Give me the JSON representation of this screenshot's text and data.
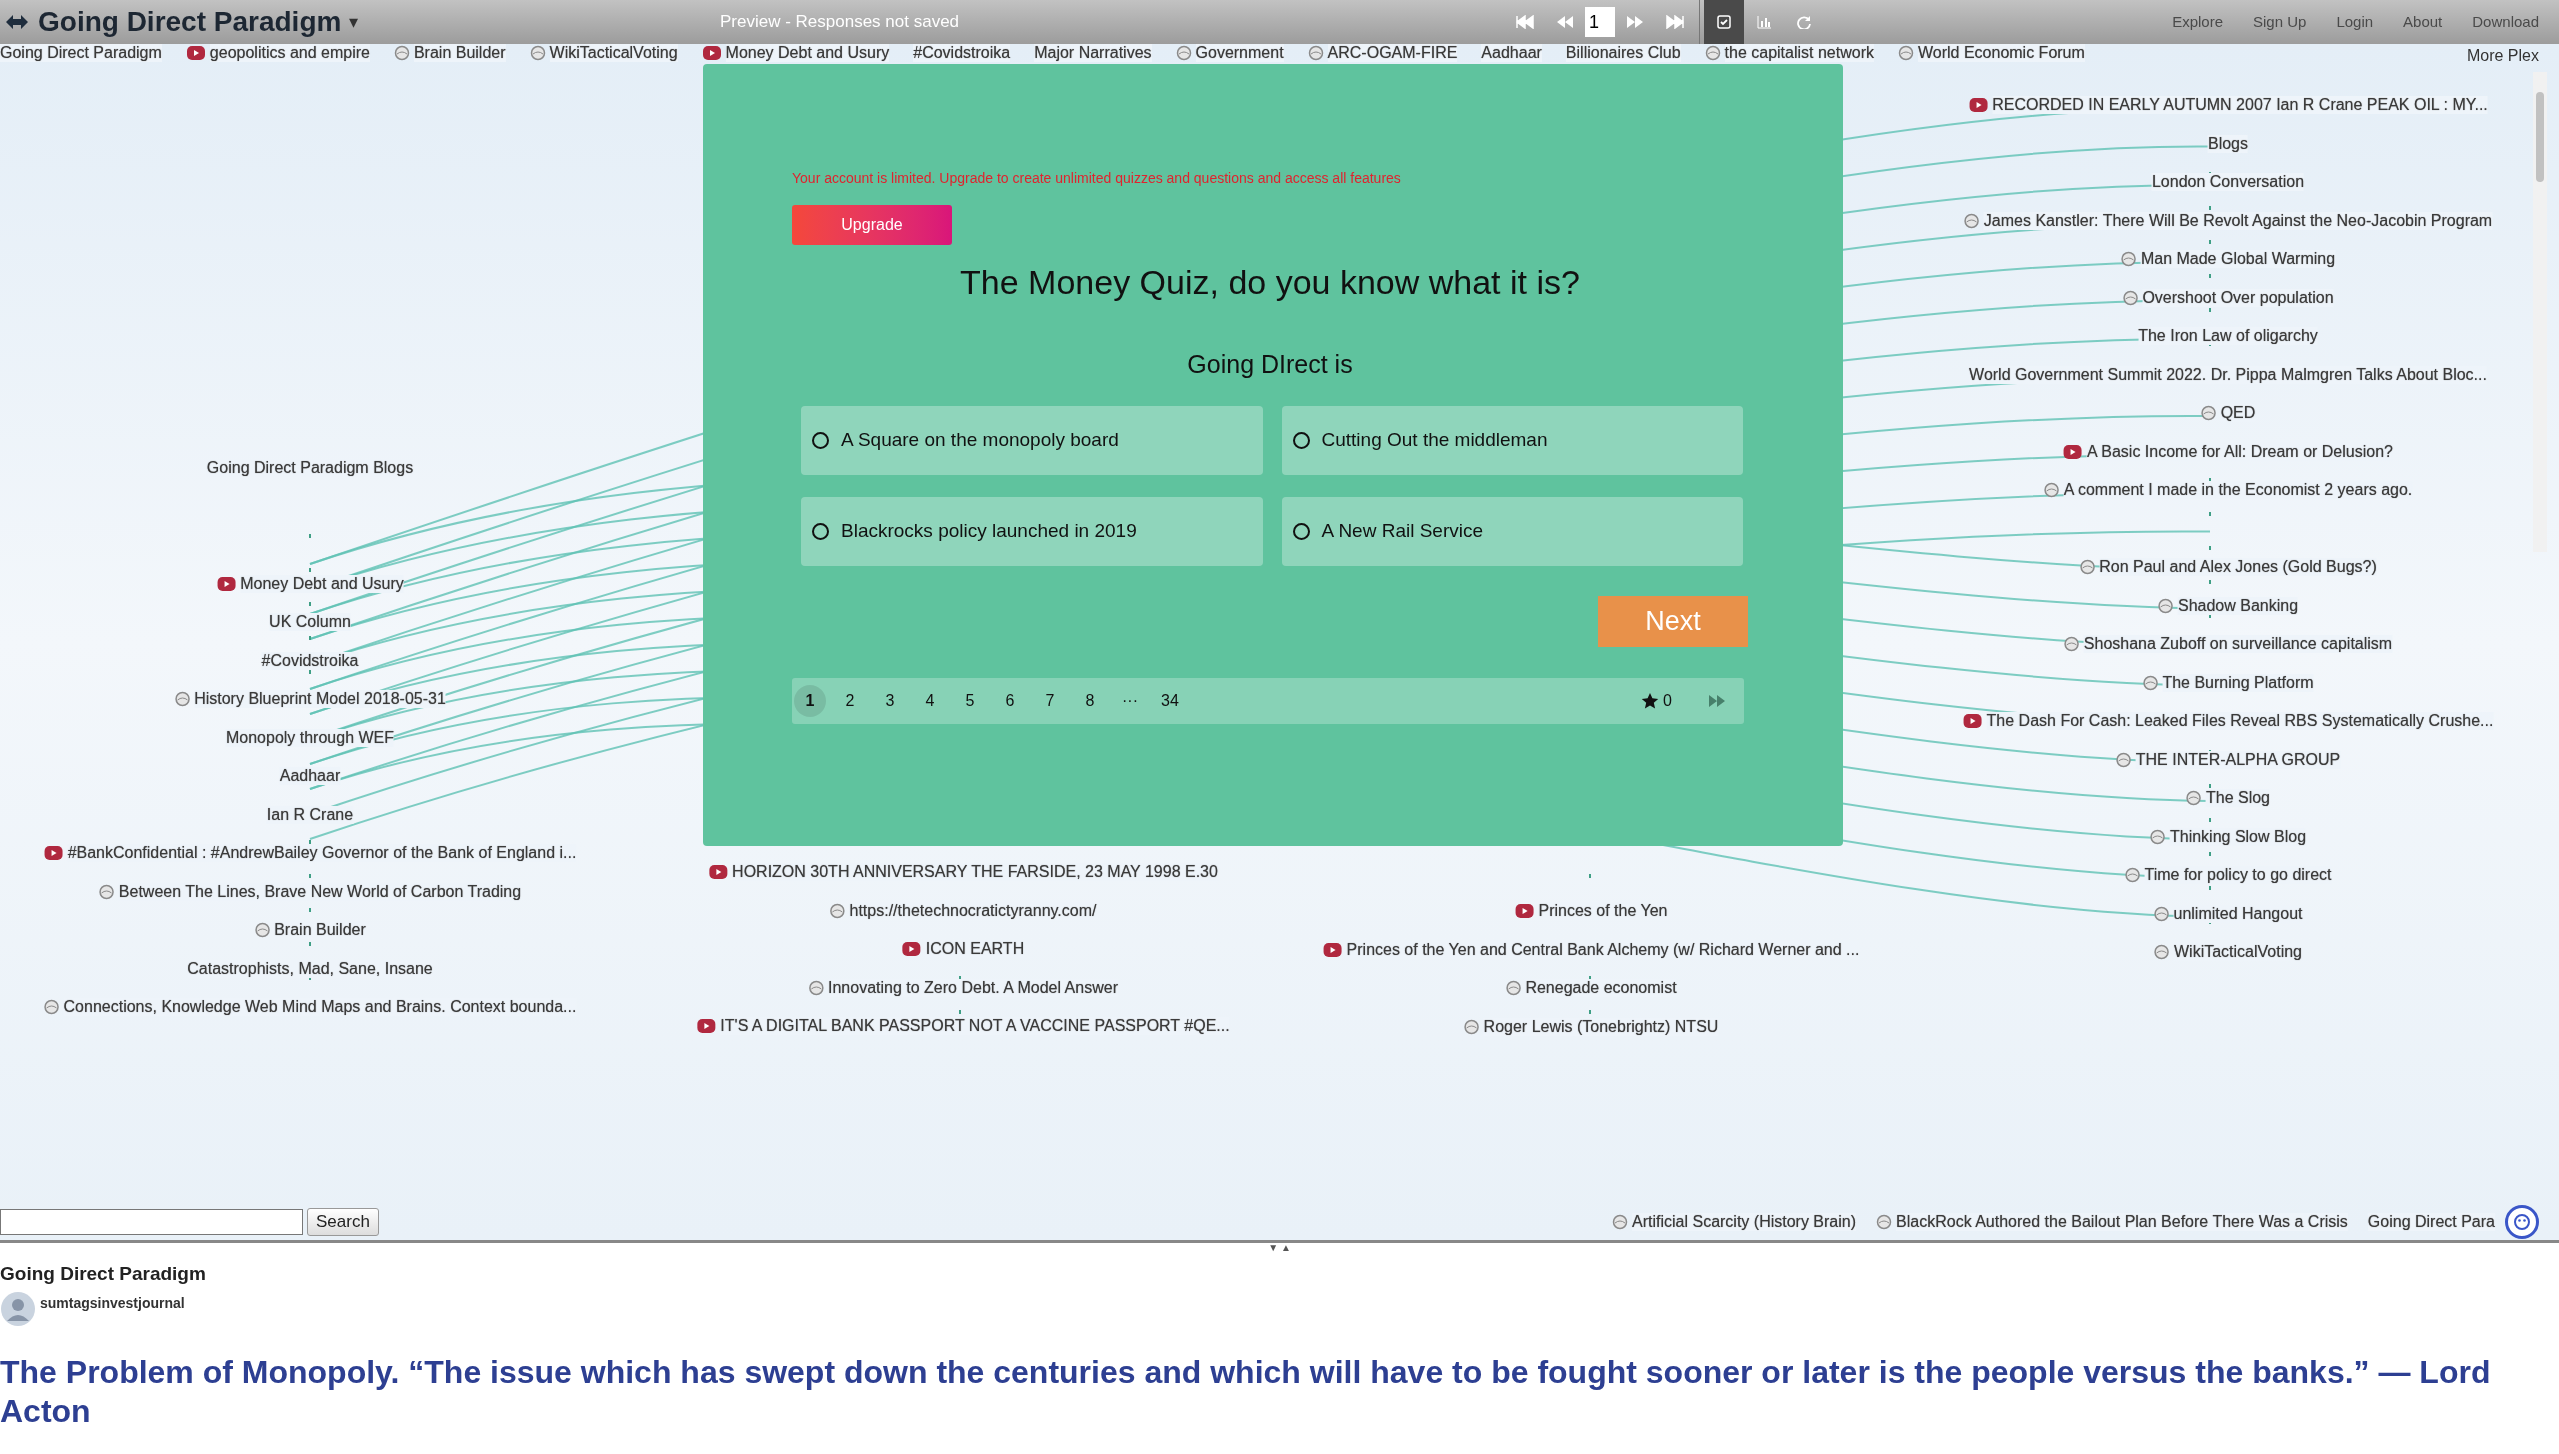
{
  "top_bar": {
    "title": "Going Direct Paradigm",
    "caret": "▾",
    "preview_note": "Preview - Responses not saved",
    "page_input": "1",
    "tools": [
      {
        "kind": "chart-check",
        "selected": true
      },
      {
        "kind": "chart-bars",
        "selected": false
      },
      {
        "kind": "refresh",
        "selected": false
      }
    ],
    "links": [
      "Explore",
      "Sign Up",
      "Login",
      "About",
      "Download"
    ]
  },
  "link_row": [
    {
      "label": "Going Direct Paradigm",
      "kind": "text"
    },
    {
      "label": "geopolitics and empire",
      "kind": "video"
    },
    {
      "label": "Brain Builder",
      "kind": "page"
    },
    {
      "label": "WikiTacticalVoting",
      "kind": "page"
    },
    {
      "label": "Money Debt and Usury",
      "kind": "video"
    },
    {
      "label": "#Covidstroika",
      "kind": "text"
    },
    {
      "label": "Major Narratives",
      "kind": "text"
    },
    {
      "label": "Government",
      "kind": "page"
    },
    {
      "label": "ARC-OGAM-FIRE",
      "kind": "page"
    },
    {
      "label": "Aadhaar",
      "kind": "text"
    },
    {
      "label": "Billionaires Club",
      "kind": "text"
    },
    {
      "label": "the capitalist network",
      "kind": "page"
    },
    {
      "label": "World Economic Forum",
      "kind": "page"
    }
  ],
  "more_label": "More Plex",
  "map_columns": [
    {
      "nodes": [
        {
          "label": "Going Direct Paradigm Blogs",
          "kind": "text"
        },
        {
          "kind": "gap"
        },
        {
          "kind": "gap"
        },
        {
          "label": "Money Debt and Usury",
          "kind": "video"
        },
        {
          "label": "UK Column",
          "kind": "text"
        },
        {
          "label": "#Covidstroika",
          "kind": "text"
        },
        {
          "label": "History Blueprint Model 2018-05-31",
          "kind": "page"
        },
        {
          "label": "Monopoly through WEF",
          "kind": "text"
        },
        {
          "label": "Aadhaar",
          "kind": "text"
        },
        {
          "label": "Ian R Crane",
          "kind": "text"
        },
        {
          "label": "#BankConfidential : #AndrewBailey Governor of the Bank of England i...",
          "kind": "video"
        },
        {
          "label": "Between The Lines, Brave New World of Carbon Trading",
          "kind": "page"
        },
        {
          "label": "Brain Builder",
          "kind": "page"
        },
        {
          "label": "Catastrophists, Mad, Sane, Insane",
          "kind": "text"
        },
        {
          "label": "Connections, Knowledge Web Mind Maps and Brains. Context bounda...",
          "kind": "page"
        }
      ]
    },
    {
      "nodes": [
        {
          "label": "HORIZON 30TH ANNIVERSARY THE FARSIDE, 23 MAY 1998 E.30",
          "kind": "video"
        },
        {
          "label": "https://thetechnocratictyranny.com/",
          "kind": "page"
        },
        {
          "label": "ICON EARTH",
          "kind": "video"
        },
        {
          "label": "Innovating to Zero Debt. A Model Answer",
          "kind": "page"
        },
        {
          "label": "IT'S A DIGITAL BANK PASSPORT NOT A VACCINE PASSPORT #QE...",
          "kind": "video"
        }
      ]
    },
    {
      "nodes": [
        {
          "label": "Princes of the Yen",
          "kind": "video"
        },
        {
          "label": "Princes of the Yen and Central Bank Alchemy (w/ Richard Werner and ...",
          "kind": "video"
        },
        {
          "label": "Renegade economist",
          "kind": "page"
        },
        {
          "label": "Roger Lewis (Tonebrightz) NTSU",
          "kind": "page"
        }
      ]
    },
    {
      "nodes": [
        {
          "label": "RECORDED IN EARLY AUTUMN 2007 Ian R Crane PEAK OIL : MY...",
          "kind": "video"
        },
        {
          "label": "Blogs",
          "kind": "text"
        },
        {
          "label": "London Conversation",
          "kind": "text"
        },
        {
          "label": "James Kanstler: There Will Be Revolt Against the Neo-Jacobin Program",
          "kind": "page"
        },
        {
          "label": "Man Made Global Warming",
          "kind": "page"
        },
        {
          "label": "Overshoot Over population",
          "kind": "page"
        },
        {
          "label": "The Iron Law of oligarchy",
          "kind": "text"
        },
        {
          "label": "World Government Summit 2022. Dr. Pippa Malmgren Talks About Bloc...",
          "kind": "text"
        },
        {
          "label": "QED",
          "kind": "page"
        },
        {
          "label": "A Basic Income for All: Dream or Delusion?",
          "kind": "video"
        },
        {
          "label": "A comment I made in the Economist 2 years ago.",
          "kind": "page"
        },
        {
          "kind": "gap"
        },
        {
          "label": "Ron Paul and Alex Jones (Gold Bugs?)",
          "kind": "page"
        },
        {
          "label": "Shadow Banking",
          "kind": "page"
        },
        {
          "label": "Shoshana Zuboff on surveillance capitalism",
          "kind": "page"
        },
        {
          "label": "The Burning Platform",
          "kind": "page"
        },
        {
          "label": "The Dash For Cash: Leaked Files Reveal RBS Systematically Crushe...",
          "kind": "video"
        },
        {
          "label": "THE INTER-ALPHA GROUP",
          "kind": "page"
        },
        {
          "label": "The Slog",
          "kind": "page"
        },
        {
          "label": "Thinking Slow Blog",
          "kind": "page"
        },
        {
          "label": "Time for policy to go direct",
          "kind": "page"
        },
        {
          "label": "unlimited Hangout",
          "kind": "page"
        },
        {
          "label": "WikiTacticalVoting",
          "kind": "page"
        }
      ]
    }
  ],
  "quiz": {
    "notice": "Your account is limited. Upgrade to create unlimited quizzes and questions and access all features",
    "upgrade_button": "Upgrade",
    "title": "The Money Quiz, do you know what it is?",
    "question": "Going DIrect is",
    "options": [
      {
        "label": "A Square on the monopoly board",
        "selected": false
      },
      {
        "label": "Cutting Out the middleman",
        "selected": false
      },
      {
        "label": "Blackrocks policy launched in 2019",
        "selected": false
      },
      {
        "label": "A New Rail Service",
        "selected": false
      }
    ],
    "next_button": "Next",
    "pages": [
      {
        "label": "1",
        "selected": true
      },
      {
        "label": "2",
        "selected": false
      },
      {
        "label": "3",
        "selected": false
      },
      {
        "label": "4",
        "selected": false
      },
      {
        "label": "5",
        "selected": false
      },
      {
        "label": "6",
        "selected": false
      },
      {
        "label": "7",
        "selected": false
      },
      {
        "label": "8",
        "selected": false
      },
      {
        "label": "···",
        "selected": false
      },
      {
        "label": "34",
        "selected": false
      }
    ],
    "score": "0"
  },
  "bottom_bar": {
    "search_button": "Search",
    "links": [
      {
        "label": "Artificial Scarcity (History Brain)",
        "kind": "page"
      },
      {
        "label": "BlackRock Authored the Bailout Plan Before There Was a Crisis",
        "kind": "page"
      },
      {
        "label": "Going Direct Para",
        "kind": "text"
      }
    ]
  },
  "splitter": "▼ ▲",
  "details": {
    "title": "Going Direct Paradigm",
    "author": "sumtagsinvestjournal",
    "heading": "The Problem of Monopoly. “The issue which has swept down the centuries and which will have to be fought sooner or later is the people versus the banks.” — Lord Acton"
  }
}
